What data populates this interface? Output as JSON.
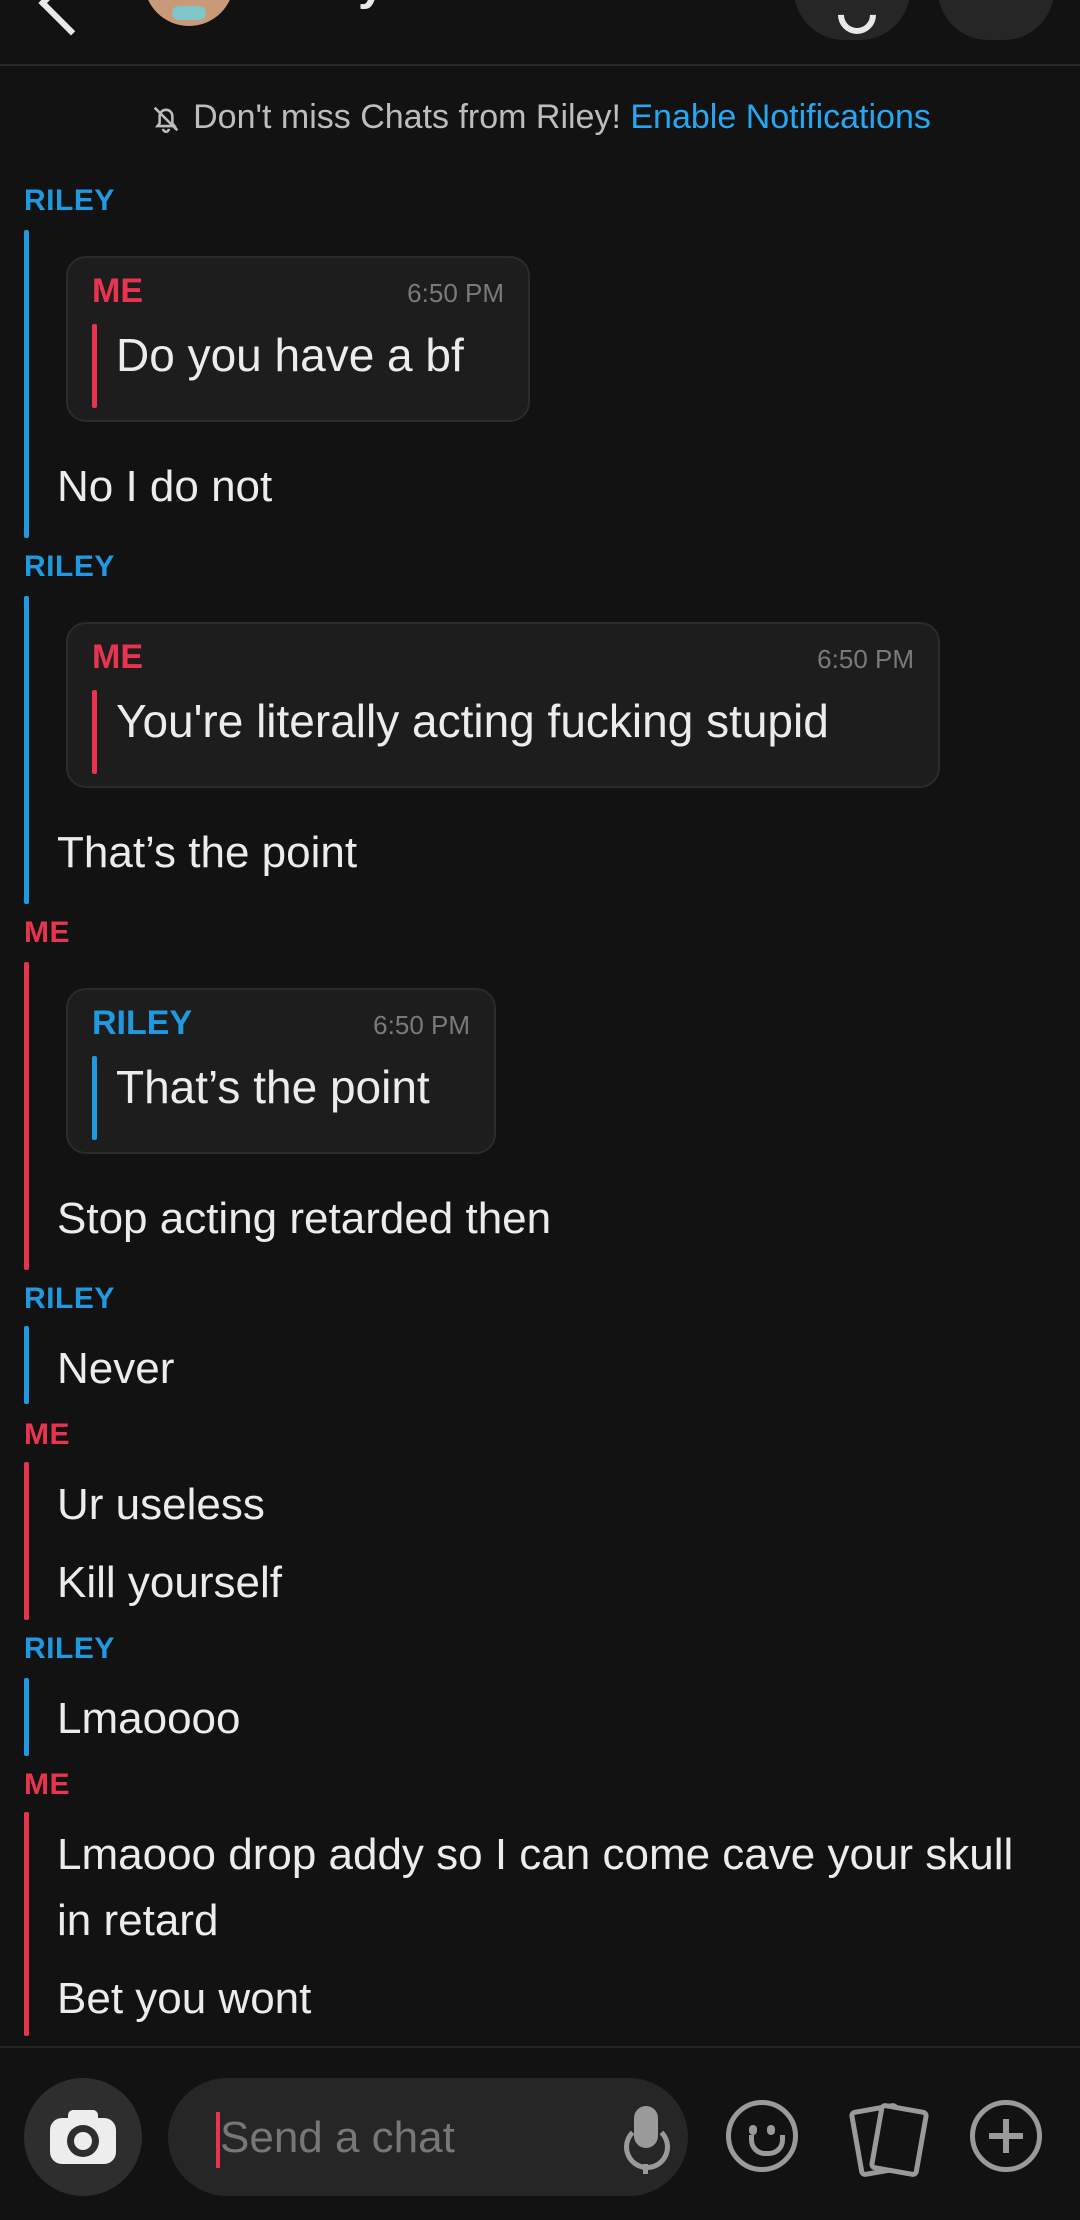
{
  "header": {
    "name": "Riley"
  },
  "banner": {
    "text": "Don't miss Chats from Riley!",
    "link": "Enable Notifications"
  },
  "messages": {
    "g1": {
      "sender": "RILEY",
      "quote_sender": "ME",
      "quote_time": "6:50 PM",
      "quote_text": "Do you have a bf",
      "text": "No I do not"
    },
    "g2": {
      "sender": "RILEY",
      "quote_sender": "ME",
      "quote_time": "6:50 PM",
      "quote_text": "You're literally acting fucking stupid",
      "text": "That’s the point"
    },
    "g3": {
      "sender": "ME",
      "quote_sender": "RILEY",
      "quote_time": "6:50 PM",
      "quote_text": "That’s the point",
      "text": "Stop acting retarded then"
    },
    "g4": {
      "sender": "RILEY",
      "text": "Never"
    },
    "g5": {
      "sender": "ME",
      "text1": "Ur useless",
      "text2": "Kill yourself"
    },
    "g6": {
      "sender": "RILEY",
      "text": "Lmaoooo"
    },
    "g7": {
      "sender": "ME",
      "text1": "Lmaooo drop addy so I can come cave your skull in retard",
      "text2": "Bet you wont"
    }
  },
  "input": {
    "placeholder": "Send a chat"
  },
  "icons": {
    "camera": "camera-icon",
    "mic": "microphone-icon",
    "emoji": "emoji-icon",
    "cards": "cards-icon",
    "plus": "plus-icon",
    "bell": "bell-off-icon"
  },
  "colors": {
    "riley": "#1f9ae0",
    "me": "#e8344e",
    "link": "#27a6f2",
    "background": "#121212"
  }
}
